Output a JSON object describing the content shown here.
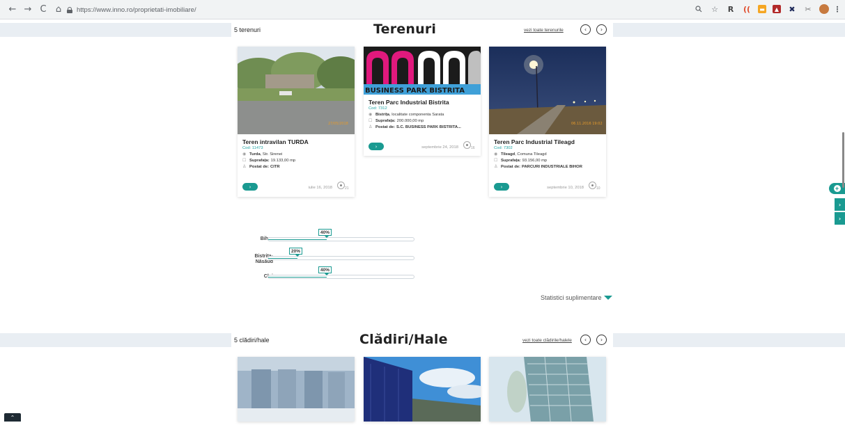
{
  "browser": {
    "url": "https://www.inno.ro/proprietati-imobiliare/",
    "nav": {
      "back": "←",
      "forward": "→",
      "reload": "C",
      "home": "⌂"
    },
    "extensions": [
      "search-icon",
      "star-icon",
      "R",
      "rss-icon",
      "ext-yellow",
      "ext-red",
      "ext-x",
      "ext-tools",
      "avatar",
      "menu-icon"
    ]
  },
  "terenuri": {
    "count": "5 terenuri",
    "title": "Terenuri",
    "view_all": "vezi toate terenurile",
    "prev": "‹",
    "next": "›",
    "cards": [
      {
        "title": "Teren intravilan TURDA",
        "code": "Cod: 11473",
        "location_bold": "Turda",
        "location_rest": ", Str. Sirenei",
        "area_label": "Suprafața:",
        "area_value": "19.133,00 mp",
        "posted_label": "Postat de:",
        "posted_value": "CITR",
        "date": "iulie 16, 2018",
        "views": "21",
        "img_stamp": "27/05/2018"
      },
      {
        "title": "Teren Parc Industrial Bistrita",
        "code": "Cod: 7312",
        "location_bold": "Bistrița",
        "location_rest": ", localitate componenta Sarata",
        "area_label": "Suprafața:",
        "area_value": "200.000,00 mp",
        "posted_label": "Postat de:",
        "posted_value": "S.C. BUSINESS PARK BISTRITA...",
        "date": "septembrie 24, 2018",
        "views": "16",
        "img_banner": "BUSINESS PARK BISTRITA"
      },
      {
        "title": "Teren Parc Industrial Tileagd",
        "code": "Cod: 7302",
        "location_bold": "Tileagd",
        "location_rest": ", Comuna Tileagd",
        "area_label": "Suprafața:",
        "area_value": "93.156,00 mp",
        "posted_label": "Postat de:",
        "posted_value": "PARCURI INDUSTRIALE BIHOR",
        "date": "septembrie 10, 2018",
        "views": "10",
        "img_stamp": "06.11.2016 19:02"
      }
    ],
    "stats": [
      {
        "label": "Bihor",
        "percent": "40%",
        "value": 0.4
      },
      {
        "label": "Bistrița-Năsăud",
        "percent": "20%",
        "value": 0.2
      },
      {
        "label": "Cluj",
        "percent": "40%",
        "value": 0.4
      }
    ],
    "more_stats": "Statistici suplimentare"
  },
  "cladiri": {
    "count": "5 clădiri/hale",
    "title": "Clădiri/Hale",
    "view_all": "vezi toate clădirile/halele",
    "prev": "‹",
    "next": "›"
  },
  "side": {
    "plus": "+",
    "tab1": "›",
    "tab2": "›"
  },
  "scroll_top": "⌃",
  "colors": {
    "accent": "#1a9a91",
    "strip": "#e9eef3"
  }
}
